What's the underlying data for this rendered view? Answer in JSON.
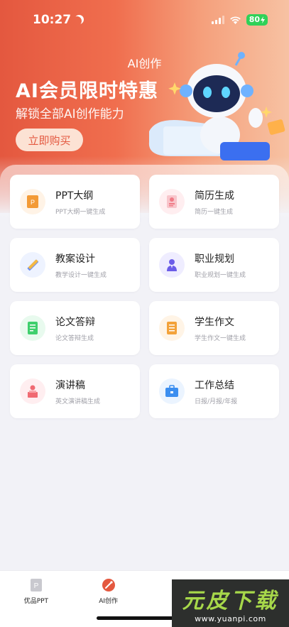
{
  "status": {
    "time": "10:27",
    "battery": "80"
  },
  "header": {
    "page_title": "AI创作",
    "promo_title": "AI会员限时特惠",
    "promo_subtitle": "解锁全部AI创作能力",
    "buy_label": "立即购买"
  },
  "cards": [
    {
      "title": "PPT大纲",
      "subtitle": "PPT大纲一键生成",
      "icon": "ppt-doc-icon",
      "bg": "#fff3e6",
      "color": "#f39a36"
    },
    {
      "title": "简历生成",
      "subtitle": "简历一键生成",
      "icon": "resume-icon",
      "bg": "#ffeef0",
      "color": "#f07a86"
    },
    {
      "title": "教案设计",
      "subtitle": "教学设计一键生成",
      "icon": "ruler-pencil-icon",
      "bg": "#eef3ff",
      "color": "#6d8ff0"
    },
    {
      "title": "职业规划",
      "subtitle": "职业规划一键生成",
      "icon": "businessman-icon",
      "bg": "#efedff",
      "color": "#6b5de8"
    },
    {
      "title": "论文答辩",
      "subtitle": "论文答辩生成",
      "icon": "document-icon",
      "bg": "#e8faee",
      "color": "#3fcf6d"
    },
    {
      "title": "学生作文",
      "subtitle": "学生作文一键生成",
      "icon": "essay-icon",
      "bg": "#fff4e6",
      "color": "#f3a23a"
    },
    {
      "title": "演讲稿",
      "subtitle": "英文演讲稿生成",
      "icon": "podium-icon",
      "bg": "#ffeef0",
      "color": "#f06a72"
    },
    {
      "title": "工作总结",
      "subtitle": "日报/月报/年报",
      "icon": "briefcase-icon",
      "bg": "#ebf4ff",
      "color": "#3b8ef0"
    }
  ],
  "tabbar": [
    {
      "label": "优品PPT",
      "icon": "ppt-tab-icon"
    },
    {
      "label": "AI创作",
      "icon": "ai-create-tab-icon"
    },
    {
      "label": "",
      "icon": "tab-3-icon"
    },
    {
      "label": "",
      "icon": "profile-tab-icon"
    }
  ],
  "watermark": {
    "main": "元皮下载",
    "sub": "www.yuanpi.com"
  },
  "colors": {
    "accent": "#e4583f",
    "background": "#f2f2f7"
  }
}
